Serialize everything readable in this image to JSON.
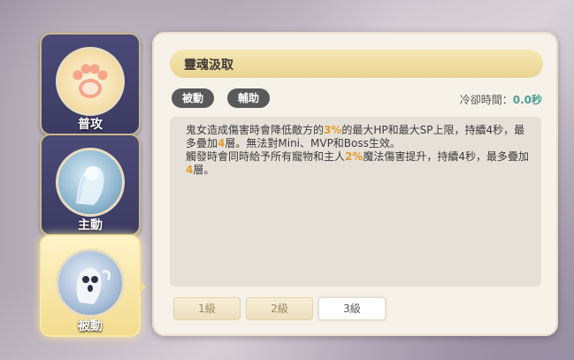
{
  "tabs": [
    {
      "label": "普攻",
      "icon": "paw-icon"
    },
    {
      "label": "主動",
      "icon": "ghost-girl-icon"
    },
    {
      "label": "被動",
      "icon": "ghost-skull-icon"
    }
  ],
  "skill": {
    "title": "靈魂汲取",
    "tags": [
      "被動",
      "輔助"
    ],
    "cooldown_label": "冷卻時間：",
    "cooldown_value": "0.0秒",
    "desc": {
      "p1_a": "鬼女造成傷害時會降低敵方的",
      "p1_hl1": "3%",
      "p1_b": "的最大HP和最大SP上限，持續4秒，最多疊加",
      "p1_hl2": "4",
      "p1_c": "層。無法對Mini、MVP和Boss生效。",
      "p2_a": "觸發時會同時給予所有寵物和主人",
      "p2_hl1": "2%",
      "p2_b": "魔法傷害提升，持續4秒，最多疊加",
      "p2_hl2": "4",
      "p2_c": "層。"
    },
    "levels": [
      "1級",
      "2級",
      "3級"
    ],
    "selected_level": "3級"
  },
  "colors": {
    "highlight": "#e39b2c",
    "cooldown": "#4a9e93",
    "tab_bg": "#3c3b63",
    "active_tab": "#f2dc8f"
  }
}
